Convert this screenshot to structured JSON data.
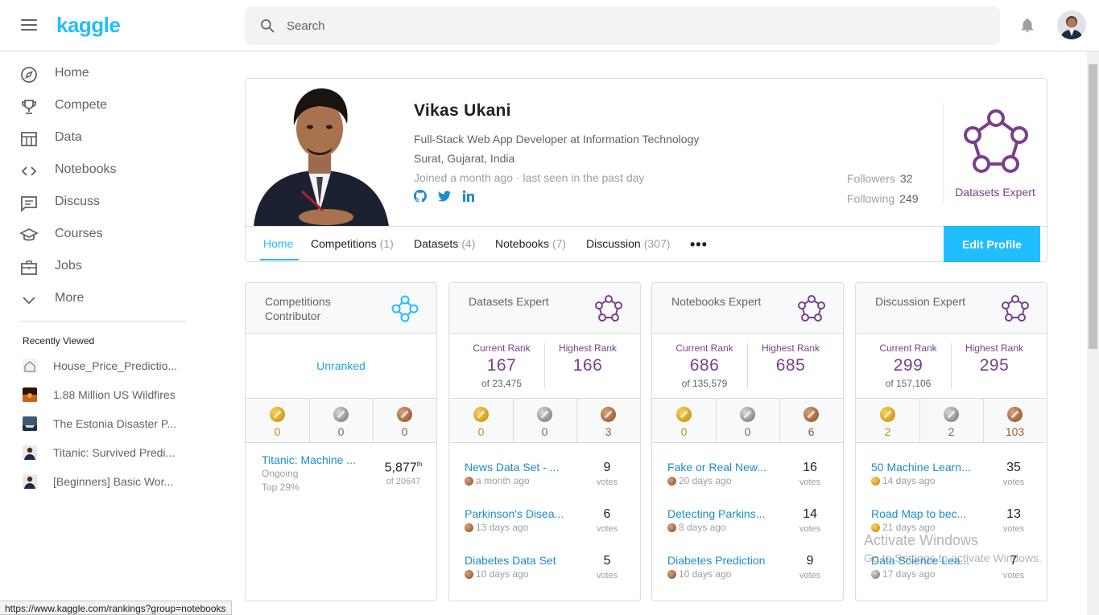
{
  "header": {
    "logo": "kaggle",
    "search_placeholder": "Search"
  },
  "sidebar": {
    "items": [
      {
        "label": "Home",
        "icon": "compass-icon"
      },
      {
        "label": "Compete",
        "icon": "trophy-icon"
      },
      {
        "label": "Data",
        "icon": "table-icon"
      },
      {
        "label": "Notebooks",
        "icon": "code-icon"
      },
      {
        "label": "Discuss",
        "icon": "chat-icon"
      },
      {
        "label": "Courses",
        "icon": "school-icon"
      },
      {
        "label": "Jobs",
        "icon": "briefcase-icon"
      },
      {
        "label": "More",
        "icon": "chevron-down-icon"
      }
    ],
    "recent_title": "Recently Viewed",
    "recent": [
      "House_Price_Predictio...",
      "1.88 Million US Wildfires",
      "The Estonia Disaster P...",
      "Titanic: Survived Predi...",
      "[Beginners] Basic Wor..."
    ]
  },
  "profile": {
    "name": "Vikas Ukani",
    "occupation": "Full-Stack Web App Developer at Information Technology",
    "location": "Surat, Gujarat, India",
    "joined": "Joined a month ago · last seen in the past day",
    "followers_label": "Followers",
    "followers": "32",
    "following_label": "Following",
    "following": "249",
    "tier": "Datasets Expert",
    "edit_button": "Edit Profile",
    "tabs": [
      {
        "label": "Home",
        "count": ""
      },
      {
        "label": "Competitions",
        "count": "(1)"
      },
      {
        "label": "Datasets",
        "count": "(4)"
      },
      {
        "label": "Notebooks",
        "count": "(7)"
      },
      {
        "label": "Discussion",
        "count": "(307)"
      }
    ],
    "more": "•••"
  },
  "cards": {
    "competitions": {
      "title": "Competitions Contributor",
      "status": "Unranked",
      "medals": [
        "0",
        "0",
        "0"
      ],
      "item": {
        "title": "Titanic: Machine ...",
        "status": "Ongoing",
        "top": "Top 29%",
        "rank": "5,877",
        "rank_suffix": "th",
        "of": "of 20647"
      }
    },
    "datasets": {
      "title": "Datasets Expert",
      "current_label": "Current Rank",
      "current": "167",
      "of": "of 23,475",
      "highest_label": "Highest Rank",
      "highest": "166",
      "medals": [
        "0",
        "0",
        "3"
      ],
      "items": [
        {
          "title": "News Data Set - ...",
          "when": "a month ago",
          "votes": "9",
          "medal": "bronze"
        },
        {
          "title": "Parkinson's Disea...",
          "when": "13 days ago",
          "votes": "6",
          "medal": "bronze"
        },
        {
          "title": "Diabetes Data Set",
          "when": "10 days ago",
          "votes": "5",
          "medal": "bronze"
        }
      ]
    },
    "notebooks": {
      "title": "Notebooks Expert",
      "current_label": "Current Rank",
      "current": "686",
      "of": "of 135,579",
      "highest_label": "Highest Rank",
      "highest": "685",
      "medals": [
        "0",
        "0",
        "6"
      ],
      "items": [
        {
          "title": "Fake or Real New...",
          "when": "20 days ago",
          "votes": "16",
          "medal": "bronze"
        },
        {
          "title": "Detecting Parkins...",
          "when": "8 days ago",
          "votes": "14",
          "medal": "bronze"
        },
        {
          "title": "Diabetes Prediction",
          "when": "10 days ago",
          "votes": "9",
          "medal": "bronze"
        }
      ]
    },
    "discussion": {
      "title": "Discussion Expert",
      "current_label": "Current Rank",
      "current": "299",
      "of": "of 157,106",
      "highest_label": "Highest Rank",
      "highest": "295",
      "medals": [
        "2",
        "2",
        "103"
      ],
      "items": [
        {
          "title": "50 Machine Learn...",
          "when": "14 days ago",
          "votes": "35",
          "medal": "gold"
        },
        {
          "title": "Road Map to bec...",
          "when": "21 days ago",
          "votes": "13",
          "medal": "gold"
        },
        {
          "title": "Data Science Lea...",
          "when": "17 days ago",
          "votes": "7",
          "medal": "silver"
        }
      ]
    },
    "votes_label": "votes"
  },
  "status_url": "https://www.kaggle.com/rankings?group=notebooks",
  "watermark": {
    "line1": "Activate Windows",
    "line2": "Go to Settings to activate Windows."
  },
  "colors": {
    "accent": "#20beff",
    "expert": "#7a3f8c",
    "contributor": "#20beff"
  }
}
